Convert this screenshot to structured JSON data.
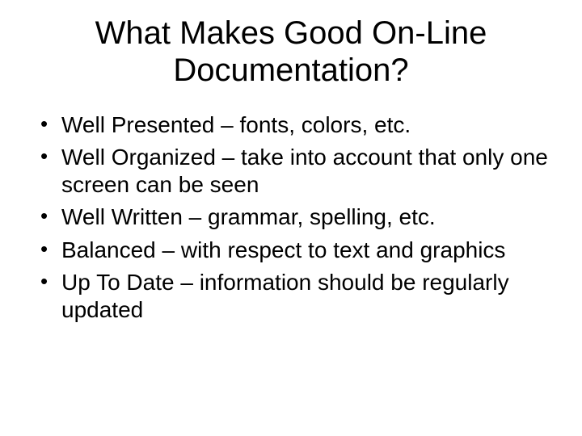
{
  "title": "What Makes Good On-Line Documentation?",
  "bullets": [
    "Well Presented – fonts, colors, etc.",
    "Well Organized – take into account that only one screen can be seen",
    "Well Written – grammar, spelling, etc.",
    "Balanced – with respect to text and graphics",
    "Up To Date – information should be regularly updated"
  ]
}
